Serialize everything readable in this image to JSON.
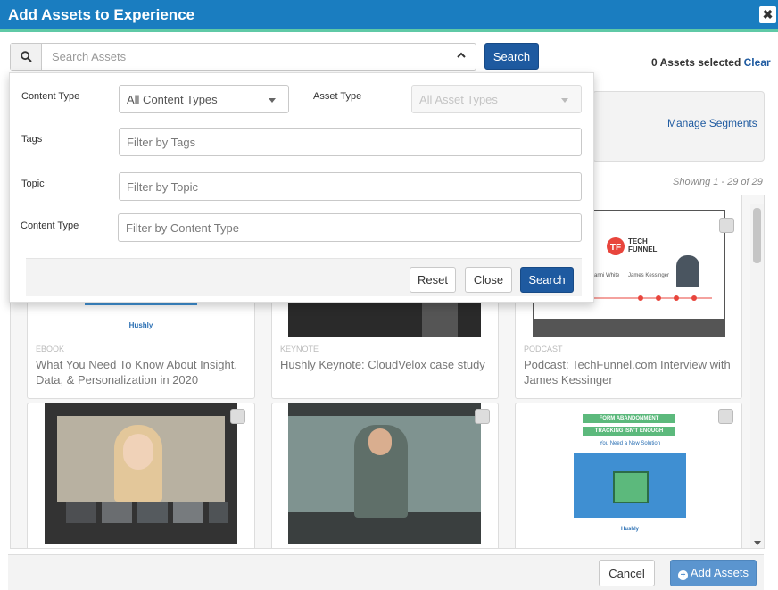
{
  "dialog": {
    "title": "Add Assets to Experience",
    "close_glyph": "✖"
  },
  "search": {
    "placeholder": "Search Assets",
    "button_label": "Search"
  },
  "selection": {
    "count_text": "0 Assets selected",
    "clear_label": "Clear"
  },
  "segments": {
    "link_label": "Manage Segments"
  },
  "results": {
    "showing_text": "Showing 1 - 29 of 29"
  },
  "filter_panel": {
    "content_type_label": "Content Type",
    "content_type_value": "All Content Types",
    "asset_type_label": "Asset Type",
    "asset_type_value": "All Asset Types",
    "tags_label": "Tags",
    "tags_placeholder": "Filter by Tags",
    "topic_label": "Topic",
    "topic_placeholder": "Filter by Topic",
    "content_type2_label": "Content Type",
    "content_type2_placeholder": "Filter by Content Type",
    "reset_label": "Reset",
    "close_label": "Close",
    "search_label": "Search"
  },
  "cards": [
    {
      "type": "EBOOK",
      "title": "What You Need To Know About Insight, Data, & Personalization in 2020",
      "thumb_brand": "Hushly"
    },
    {
      "type": "KEYNOTE",
      "title": "Hushly Keynote: CloudVelox case study"
    },
    {
      "type": "PODCAST",
      "title": "Podcast: TechFunnel.com Interview with James Kessinger",
      "thumb_brand": "TECH FUNNEL",
      "thumb_names": [
        "Gianni White",
        "James Kessinger"
      ]
    },
    {
      "type": "",
      "title": ""
    },
    {
      "type": "",
      "title": ""
    },
    {
      "type": "",
      "title": "",
      "thumb_heading1": "FORM ABANDONMENT",
      "thumb_heading2": "TRACKING ISN'T ENOUGH",
      "thumb_sub": "You Need a New Solution",
      "thumb_brand": "Hushly"
    }
  ],
  "footer": {
    "cancel_label": "Cancel",
    "add_label": "Add Assets"
  },
  "colors": {
    "header_bg": "#1a7dc0",
    "header_accent": "#5fc9a6",
    "primary": "#1e5aa0",
    "add_button": "#5b95cf"
  }
}
